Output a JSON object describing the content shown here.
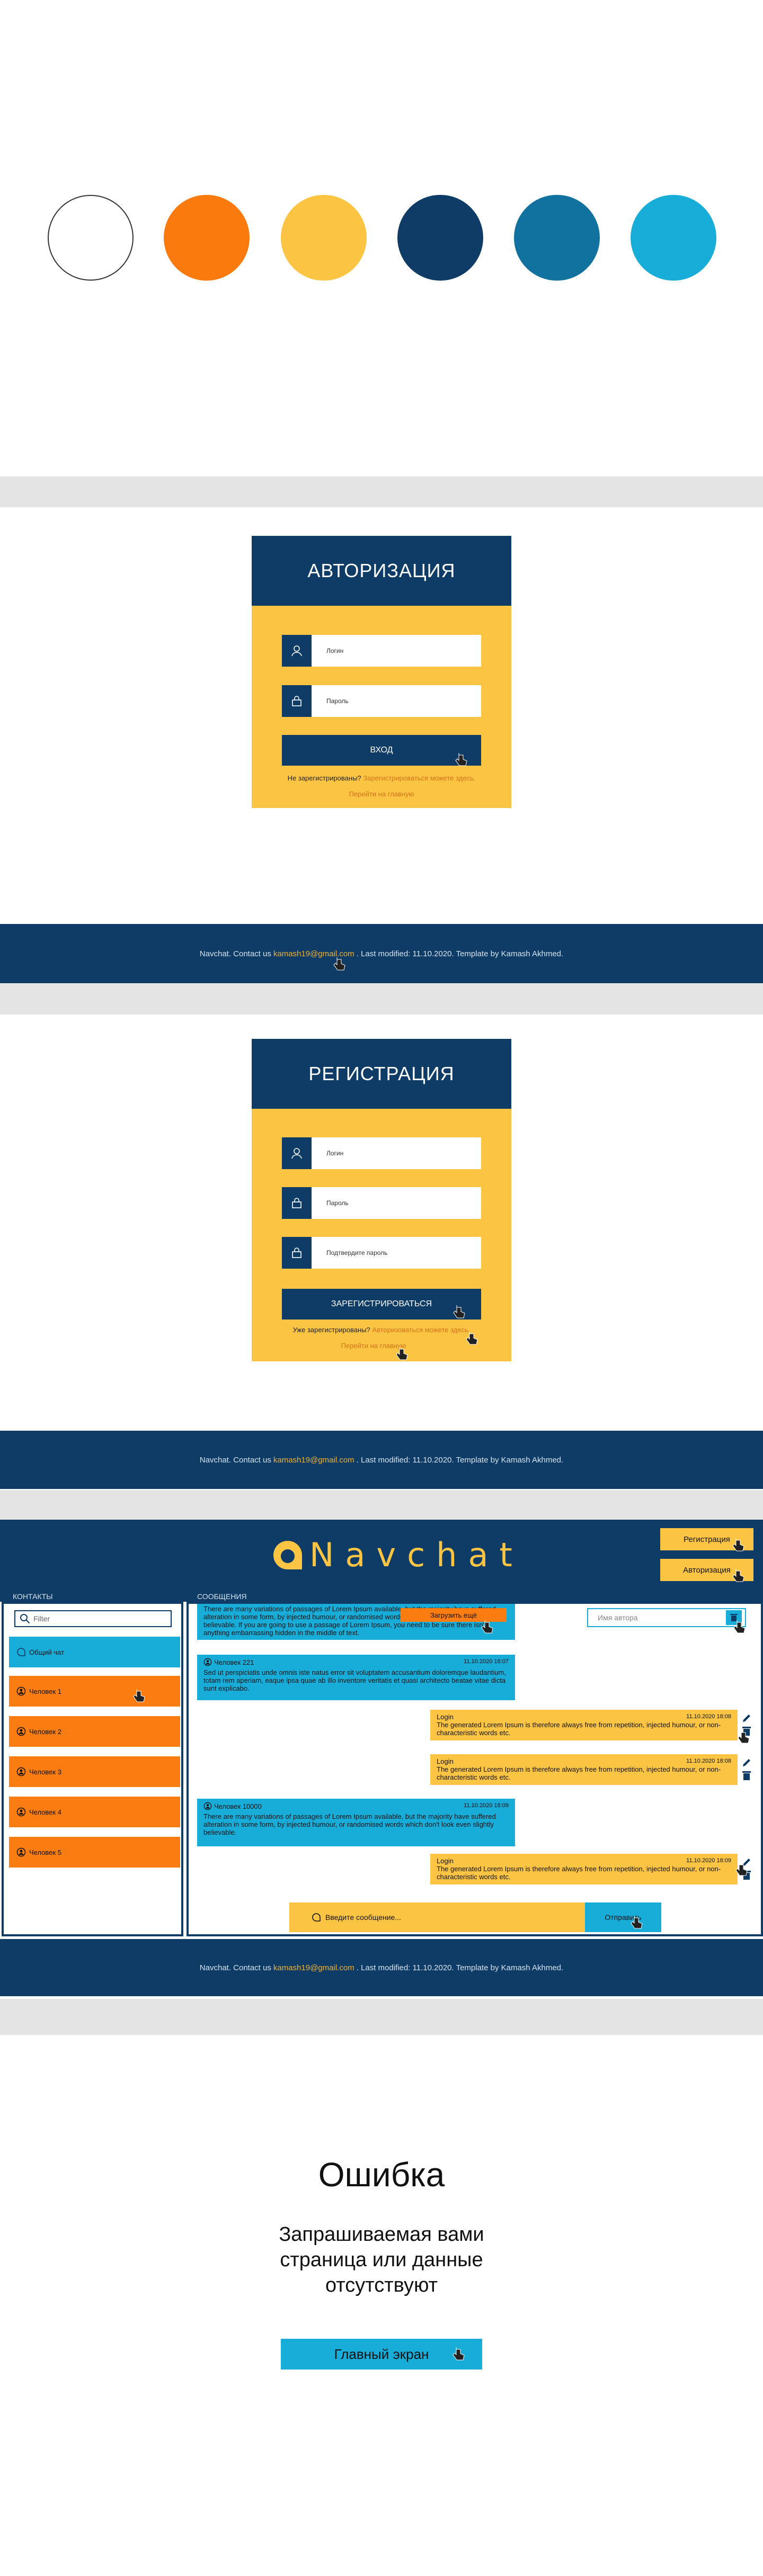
{
  "palette": {
    "colors": [
      "#ffffff",
      "#fb7a0e",
      "#fcc443",
      "#0e3c66",
      "#11719f",
      "#18acd8"
    ]
  },
  "login": {
    "title": "АВТОРИЗАЦИЯ",
    "login_placeholder": "Логин",
    "password_placeholder": "Пароль",
    "submit_label": "ВХОД",
    "not_registered": "Не зарегистрированы?",
    "register_link": "Зарегистрироваться можете здесь.",
    "home_link": "Перейти на главную"
  },
  "register": {
    "title": "РЕГИСТРАЦИЯ",
    "login_placeholder": "Логин",
    "password_placeholder": "Пароль",
    "confirm_placeholder": "Подтвердите пароль",
    "submit_label": "ЗАРЕГИСТРИРОВАТЬСЯ",
    "already_registered": "Уже зарегистрированы?",
    "login_link": "Авторизоваться можете здесь.",
    "home_link": "Перейти на главную"
  },
  "footer": {
    "prefix": "Navchat. Contact us",
    "email": "kamash19@gmail.com",
    "suffix": ". Last modified: 11.10.2020. Template by Kamash Akhmed."
  },
  "chat": {
    "logo_text": "Navchat",
    "register_button": "Регистрация",
    "login_button": "Авторизация",
    "contacts_label": "КОНТАКТЫ",
    "messages_label": "СООБЩЕНИЯ",
    "filter_placeholder": "Filter",
    "author_placeholder": "Имя автора",
    "upload_label": "Загрузить ещё",
    "general_chat": "Общий чат",
    "contacts": [
      "Человек 1",
      "Человек 2",
      "Человек 3",
      "Человек 4",
      "Человек 5"
    ],
    "messages": [
      {
        "text": "There are many variations of passages of Lorem Ipsum available, but the majority have suffered alteration in some form, by injected humour, or randomised words which don't look even slightly believable. If you are going to use a passage of Lorem Ipsum, you need to be sure there isn't anything embarrassing hidden in the middle of text."
      },
      {
        "author": "Человек 221",
        "time": "11.10.2020 18:07",
        "text": "Sed ut perspiciatis unde omnis iste natus error sit voluptatem accusantium doloremque laudantium, totam rem aperiam, eaque ipsa quae ab illo inventore veritatis et quasi architecto beatae vitae dicta sunt explicabo."
      },
      {
        "author": "Login",
        "time": "11.10.2020 18:08",
        "text": "The generated Lorem Ipsum is therefore always free from repetition, injected humour, or non-characteristic words etc."
      },
      {
        "author": "Login",
        "time": "11.10.2020 18:08",
        "text": "The generated Lorem Ipsum is therefore always free from repetition, injected humour, or non-characteristic words etc."
      },
      {
        "author": "Человек 10000",
        "time": "11.10.2020 18:09",
        "text": "There are many variations of passages of Lorem Ipsum available, but the majority have suffered alteration in some form, by injected humour, or randomised words which don't look even slightly believable."
      },
      {
        "author": "Login",
        "time": "11.10.2020 18:09",
        "text": "The generated Lorem Ipsum is therefore always free from repetition, injected humour, or non-characteristic words etc."
      }
    ],
    "input_placeholder": "Введите сообщение...",
    "send_label": "Отправить"
  },
  "error": {
    "title": "Ошибка",
    "message": "Запрашиваемая вами страница или данные отсутствуют",
    "home_button": "Главный экран"
  }
}
